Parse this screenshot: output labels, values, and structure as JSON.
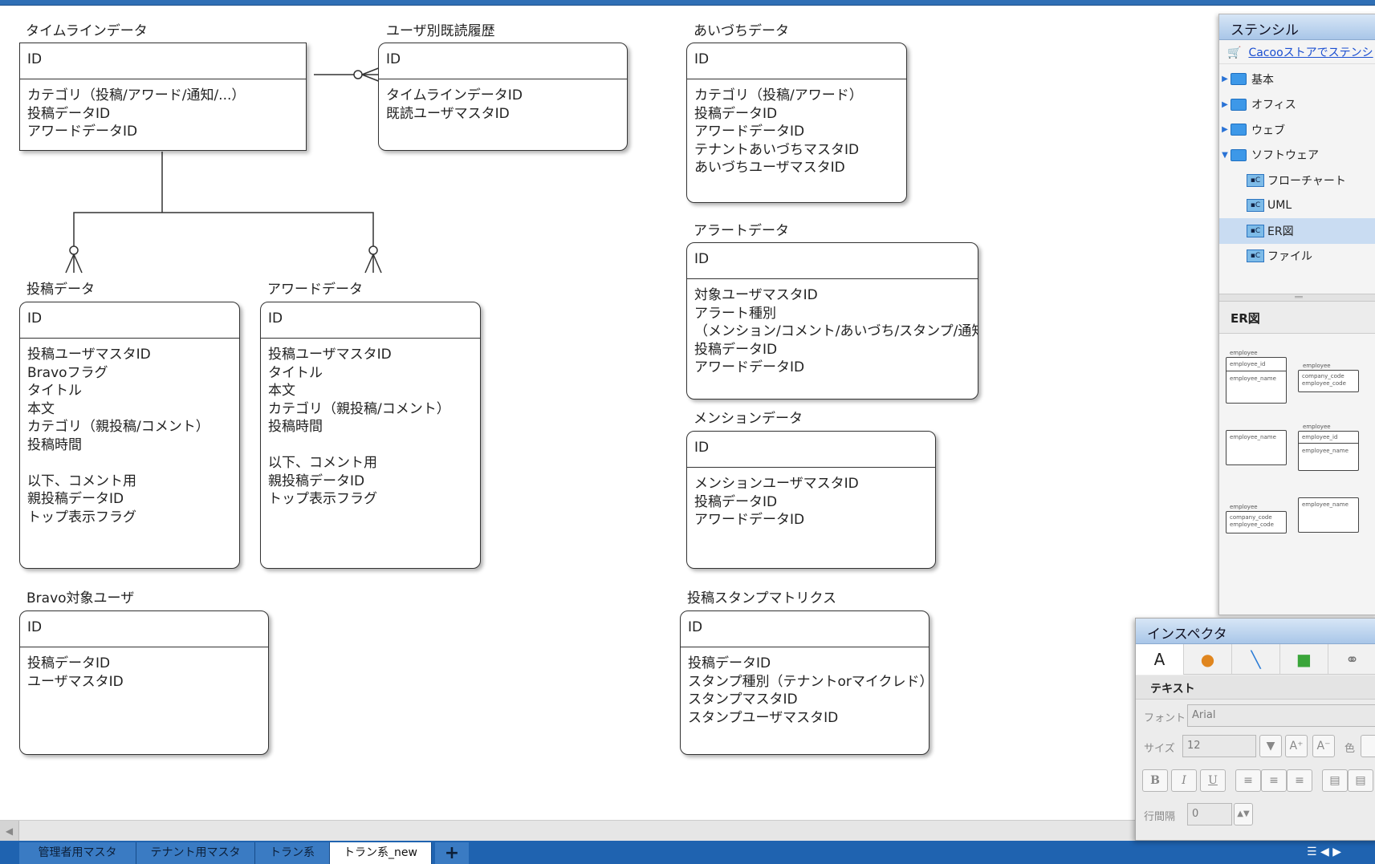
{
  "entities": [
    {
      "title": "タイムラインデータ",
      "id": "ID",
      "fields": [
        "カテゴリ（投稿/アワード/通知/...）",
        "投稿データID",
        "アワードデータID"
      ]
    },
    {
      "title": "ユーザ別既読履歴",
      "id": "ID",
      "fields": [
        "タイムラインデータID",
        "既読ユーザマスタID"
      ]
    },
    {
      "title": "あいづちデータ",
      "id": "ID",
      "fields": [
        "カテゴリ（投稿/アワード）",
        "投稿データID",
        "アワードデータID",
        "テナントあいづちマスタID",
        "あいづちユーザマスタID"
      ]
    },
    {
      "title": "アラートデータ",
      "id": "ID",
      "fields": [
        "対象ユーザマスタID",
        "アラート種別",
        "（メンション/コメント/あいづち/スタンプ/通知...）",
        "投稿データID",
        "アワードデータID"
      ]
    },
    {
      "title": "メンションデータ",
      "id": "ID",
      "fields": [
        "メンションユーザマスタID",
        "投稿データID",
        "アワードデータID"
      ]
    },
    {
      "title": "投稿データ",
      "id": "ID",
      "fields": [
        "投稿ユーザマスタID",
        "Bravoフラグ",
        "タイトル",
        "本文",
        "カテゴリ（親投稿/コメント）",
        "投稿時間",
        "",
        "以下、コメント用",
        "親投稿データID",
        "トップ表示フラグ"
      ]
    },
    {
      "title": "アワードデータ",
      "id": "ID",
      "fields": [
        "投稿ユーザマスタID",
        "タイトル",
        "本文",
        "カテゴリ（親投稿/コメント）",
        "投稿時間",
        "",
        "以下、コメント用",
        "親投稿データID",
        "トップ表示フラグ"
      ]
    },
    {
      "title": "Bravo対象ユーザ",
      "id": "ID",
      "fields": [
        "投稿データID",
        "ユーザマスタID"
      ]
    },
    {
      "title": "投稿スタンプマトリクス",
      "id": "ID",
      "fields": [
        "投稿データID",
        "スタンプ種別（テナントorマイクレド）",
        "スタンプマスタID",
        "スタンプユーザマスタID"
      ]
    }
  ],
  "sheet_tabs": [
    "管理者用マスタ",
    "テナント用マスタ",
    "トラン系",
    "トラン系_new"
  ],
  "active_tab": "トラン系_new",
  "add_tab_label": "+",
  "stencil": {
    "title": "ステンシル",
    "store_link": "Cacooストアでステンシ",
    "tree": [
      "基本",
      "オフィス",
      "ウェブ",
      "ソフトウェア",
      "フローチャート",
      "UML",
      "ER図",
      "ファイル"
    ],
    "selected": "ER図",
    "section_title": "ER図",
    "thumb_labels": [
      "employee",
      "employee_id",
      "employee_name",
      "employee",
      "company_code",
      "employee_code",
      "employee",
      "employee_id",
      "employee_name",
      "employee_name",
      "employee",
      "company_code",
      "employee_code",
      "employee_name"
    ]
  },
  "inspector": {
    "title": "インスペクタ",
    "tools": [
      "A",
      "fill-icon",
      "line-icon",
      "shape-icon",
      "link-icon"
    ],
    "section": "テキスト",
    "font_label": "フォント",
    "font_value": "Arial",
    "size_label": "サイズ",
    "size_value": "12",
    "color_label": "色",
    "line_spacing_label": "行間隔",
    "line_spacing_value": "0",
    "bold": "B",
    "italic": "I",
    "underline": "U"
  },
  "colors": {
    "tabbar": "#1f63b0",
    "panel_header": "#a9c6e8",
    "link": "#1b4fd1"
  }
}
